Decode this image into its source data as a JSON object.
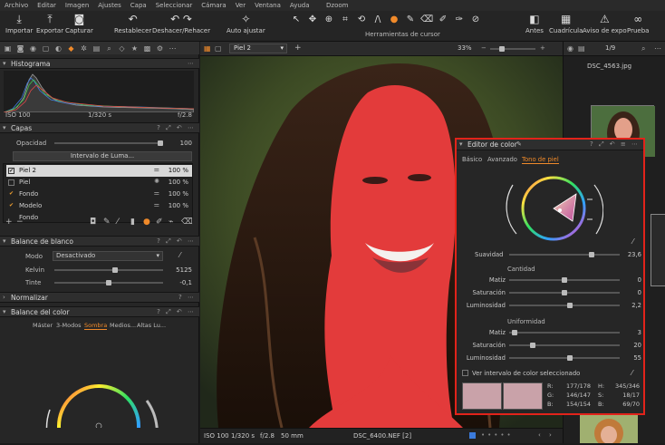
{
  "menubar": {
    "items": [
      "Archivo",
      "Editar",
      "Imagen",
      "Ajustes",
      "Capa",
      "Seleccionar",
      "Cámara",
      "Ver",
      "Ventana",
      "Ayuda"
    ],
    "title": "Dzoom"
  },
  "toolbar": {
    "import": "Importar",
    "export": "Exportar",
    "capture": "Capturar",
    "reset": "Restablecer",
    "undo_redo": "Deshacer/Rehacer",
    "auto_adjust": "Auto ajustar",
    "cursor_tools": "Herramientas de cursor",
    "before": "Antes",
    "grid": "Cuadrícula",
    "exposure_warning": "Aviso de expo",
    "proof": "Prueba"
  },
  "histogram": {
    "title": "Histograma",
    "iso": "ISO 100",
    "shutter": "1/320 s",
    "aperture": "f/2.8"
  },
  "layers": {
    "title": "Capas",
    "opacity_label": "Opacidad",
    "opacity_value": "100",
    "opacity_level": 1.0,
    "luma_button": "Intervalo de Luma...",
    "rows": [
      {
        "name": "Piel 2",
        "pct": "100 %",
        "checked": "✔"
      },
      {
        "name": "Piel",
        "pct": "100 %",
        "checked": ""
      },
      {
        "name": "Fondo",
        "pct": "100 %",
        "checked": "✔"
      },
      {
        "name": "Modelo",
        "pct": "100 %",
        "checked": "✔"
      },
      {
        "name": "Fondo",
        "pct": "",
        "checked": ""
      }
    ]
  },
  "white_balance": {
    "title": "Balance de blanco",
    "mode_label": "Modo",
    "mode_value": "Desactivado",
    "kelvin_label": "Kelvin",
    "kelvin_value": "5125",
    "tint_label": "Tinte",
    "tint_value": "-0,1"
  },
  "normalize": {
    "title": "Normalizar"
  },
  "color_balance": {
    "title": "Balance del color",
    "tabs": [
      "Máster",
      "3-Modos",
      "Sombra",
      "Medios...",
      "Altas Lu..."
    ],
    "active_tab": "Sombra"
  },
  "viewer": {
    "variant_name": "Piel 2",
    "zoom": "33%",
    "bottom_iso": "ISO 100",
    "bottom_shutter": "1/320 s",
    "bottom_aperture": "f/2.8",
    "bottom_focal": "50 mm",
    "bottom_file": "DSC_6400.NEF [2]"
  },
  "browser": {
    "count": "1/9",
    "filename": "DSC_4563.jpg"
  },
  "color_editor": {
    "title": "Editor de color",
    "tabs": [
      "Básico",
      "Avanzado",
      "Tono de piel"
    ],
    "active_tab": "Tono de piel",
    "smoothness_label": "Suavidad",
    "smoothness_value": "23,6",
    "amount_title": "Cantidad",
    "amount": [
      {
        "label": "Matiz",
        "value": "0",
        "level": 0.5
      },
      {
        "label": "Saturación",
        "value": "0",
        "level": 0.5
      },
      {
        "label": "Luminosidad",
        "value": "2,2",
        "level": 0.55
      }
    ],
    "uniformity_title": "Uniformidad",
    "uniformity": [
      {
        "label": "Matiz",
        "value": "3",
        "level": 0.03
      },
      {
        "label": "Saturación",
        "value": "20",
        "level": 0.2
      },
      {
        "label": "Luminosidad",
        "value": "55",
        "level": 0.55
      }
    ],
    "show_range_label": "Ver intervalo de color seleccionado",
    "readout": {
      "r_label": "R:",
      "r_value": "177/178",
      "g_label": "G:",
      "g_value": "146/147",
      "b_label": "B:",
      "b_value": "154/154",
      "h_label": "H:",
      "h_value": "345/346",
      "s_label": "S:",
      "s_value": "18/17",
      "bb_label": "B:",
      "bb_value": "69/70"
    },
    "swatch_color": "#c9a2a9"
  },
  "colors": {
    "accent": "#f08a2a",
    "highlight_border": "#e2231a",
    "mask_red": "#e33b3b"
  }
}
